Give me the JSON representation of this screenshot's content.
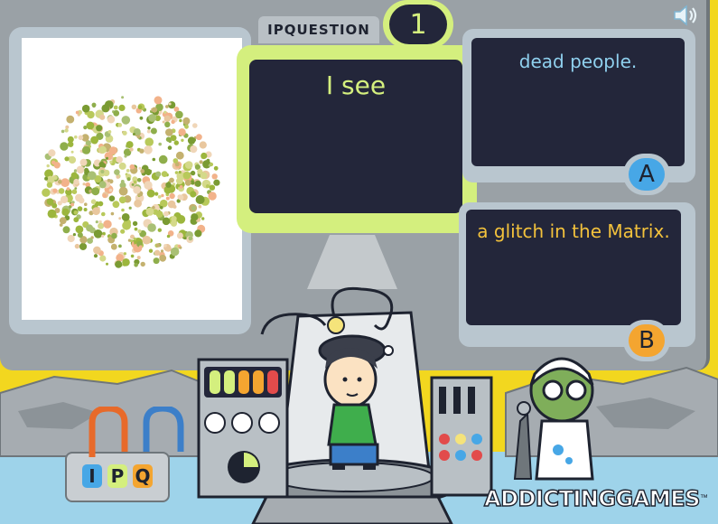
{
  "header": {
    "tab_label": "IPQUESTION",
    "question_number": "1",
    "sound_icon": "speaker-icon"
  },
  "question": {
    "prompt": "I see"
  },
  "answers": [
    {
      "key": "A",
      "text": "dead people.",
      "color": "#47a7e6"
    },
    {
      "key": "B",
      "text": "a glitch in the Matrix.",
      "color": "#f4a530"
    }
  ],
  "ipq_panel": {
    "letters": [
      {
        "char": "I",
        "color": "#47a7e6"
      },
      {
        "char": "P",
        "color": "#d4ef7e"
      },
      {
        "char": "Q",
        "color": "#f4a530"
      }
    ]
  },
  "logo": {
    "text": "ADDICTINGGAMES",
    "trademark": "™"
  },
  "colors": {
    "accent_green": "#d4ef7e",
    "screen_dark": "#23263a",
    "panel_gray": "#b9c6cf",
    "background_yellow": "#f2d71f"
  }
}
